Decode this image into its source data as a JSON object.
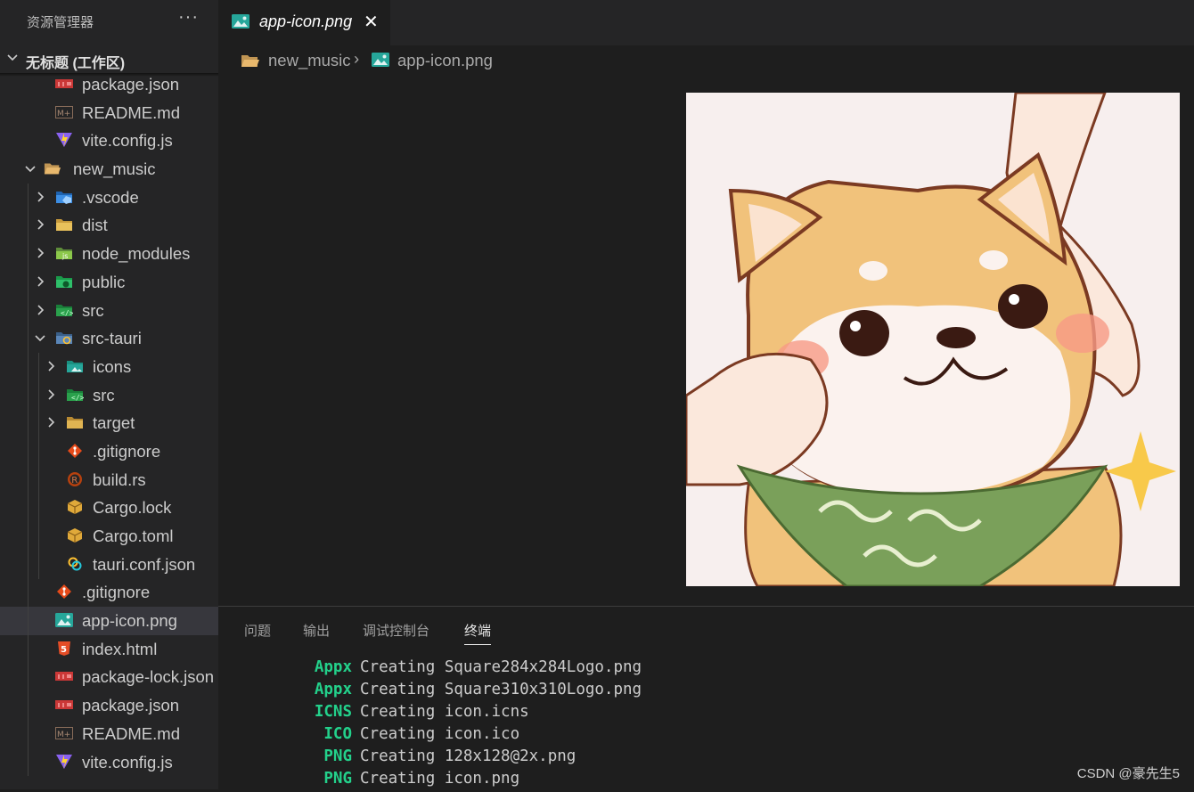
{
  "sidebar": {
    "title": "资源管理器",
    "more": "···",
    "workspace": "无标题 (工作区)",
    "items": [
      {
        "label": "package.json",
        "icon": "npm-icon",
        "depth": 1
      },
      {
        "label": "README.md",
        "icon": "markdown-icon",
        "depth": 1
      },
      {
        "label": "vite.config.js",
        "icon": "vite-icon",
        "depth": 1
      },
      {
        "label": "new_music",
        "icon": "folder-open-icon",
        "depth": 0,
        "chevron": "down"
      },
      {
        "label": ".vscode",
        "icon": "vscode-folder-icon",
        "depth": 1,
        "chevron": "right"
      },
      {
        "label": "dist",
        "icon": "dist-folder-icon",
        "depth": 1,
        "chevron": "right"
      },
      {
        "label": "node_modules",
        "icon": "node-folder-icon",
        "depth": 1,
        "chevron": "right"
      },
      {
        "label": "public",
        "icon": "public-folder-icon",
        "depth": 1,
        "chevron": "right"
      },
      {
        "label": "src",
        "icon": "src-folder-icon",
        "depth": 1,
        "chevron": "right"
      },
      {
        "label": "src-tauri",
        "icon": "tauri-folder-icon",
        "depth": 1,
        "chevron": "down"
      },
      {
        "label": "icons",
        "icon": "images-folder-icon",
        "depth": 2,
        "chevron": "right"
      },
      {
        "label": "src",
        "icon": "src-folder-icon",
        "depth": 2,
        "chevron": "right"
      },
      {
        "label": "target",
        "icon": "target-folder-icon",
        "depth": 2,
        "chevron": "right"
      },
      {
        "label": ".gitignore",
        "icon": "git-icon",
        "depth": 2
      },
      {
        "label": "build.rs",
        "icon": "rust-icon",
        "depth": 2
      },
      {
        "label": "Cargo.lock",
        "icon": "cargo-icon",
        "depth": 2
      },
      {
        "label": "Cargo.toml",
        "icon": "cargo-icon",
        "depth": 2
      },
      {
        "label": "tauri.conf.json",
        "icon": "tauri-icon",
        "depth": 2
      },
      {
        "label": ".gitignore",
        "icon": "git-icon",
        "depth": 1
      },
      {
        "label": "app-icon.png",
        "icon": "image-icon",
        "depth": 1,
        "selected": true
      },
      {
        "label": "index.html",
        "icon": "html-icon",
        "depth": 1
      },
      {
        "label": "package-lock.json",
        "icon": "npm-icon",
        "depth": 1
      },
      {
        "label": "package.json",
        "icon": "npm-icon",
        "depth": 1
      },
      {
        "label": "README.md",
        "icon": "markdown-icon",
        "depth": 1
      },
      {
        "label": "vite.config.js",
        "icon": "vite-icon",
        "depth": 1
      }
    ]
  },
  "editor": {
    "tab": {
      "title": "app-icon.png",
      "icon": "image-icon",
      "close": "✕"
    },
    "breadcrumb": {
      "folder": "new_music",
      "separator": "›",
      "file": "app-icon.png"
    }
  },
  "panel": {
    "tabs": [
      {
        "label": "问题"
      },
      {
        "label": "输出"
      },
      {
        "label": "调试控制台"
      },
      {
        "label": "终端",
        "active": true
      }
    ],
    "terminal": [
      {
        "kw": "Appx",
        "msg": "Creating Square284x284Logo.png"
      },
      {
        "kw": "Appx",
        "msg": "Creating Square310x310Logo.png"
      },
      {
        "kw": "ICNS",
        "msg": "Creating icon.icns"
      },
      {
        "kw": "ICO",
        "msg": "Creating icon.ico"
      },
      {
        "kw": "PNG",
        "msg": "Creating 128x128@2x.png"
      },
      {
        "kw": "PNG",
        "msg": "Creating icon.png"
      }
    ],
    "terminal_accent": "#23d18b"
  },
  "watermark": "CSDN @豪先生5",
  "colors": {
    "background": "#1e1e1e",
    "sidebar": "#252526",
    "selection": "#37373d"
  }
}
